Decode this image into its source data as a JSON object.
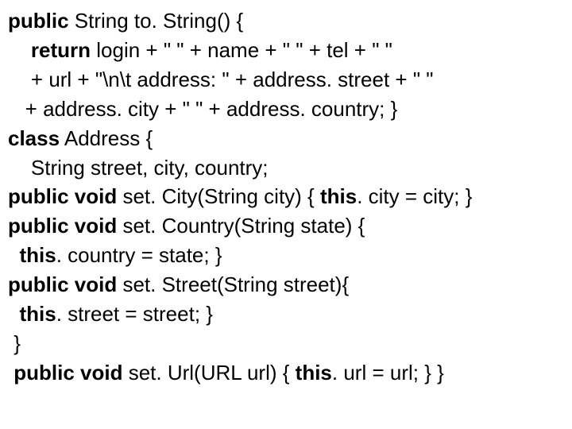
{
  "code": {
    "lines": [
      {
        "indent": "",
        "segments": [
          {
            "t": "public",
            "kw": true
          },
          {
            "t": " String to. String() { ",
            "kw": false
          }
        ]
      },
      {
        "indent": "    ",
        "segments": [
          {
            "t": "return",
            "kw": true
          },
          {
            "t": " login + \" \" + name + \" \" + tel + \" \"",
            "kw": false
          }
        ]
      },
      {
        "indent": "    ",
        "segments": [
          {
            "t": "+ url + \"\\n\\t address: \" + address. street + \" \"",
            "kw": false
          }
        ]
      },
      {
        "indent": "   ",
        "segments": [
          {
            "t": "+ address. city + \" \" + address. country; }",
            "kw": false
          }
        ]
      },
      {
        "indent": "",
        "segments": [
          {
            "t": "class",
            "kw": true
          },
          {
            "t": " Address {",
            "kw": false
          }
        ]
      },
      {
        "indent": "    ",
        "segments": [
          {
            "t": "String street, city, country;",
            "kw": false
          }
        ]
      },
      {
        "indent": "",
        "segments": [
          {
            "t": "public void",
            "kw": true
          },
          {
            "t": " set. City(String city) { ",
            "kw": false
          },
          {
            "t": "this",
            "kw": true
          },
          {
            "t": ". city = city; }",
            "kw": false
          }
        ]
      },
      {
        "indent": "",
        "segments": [
          {
            "t": "public void",
            "kw": true
          },
          {
            "t": " set. Country(String state) {",
            "kw": false
          }
        ]
      },
      {
        "indent": "  ",
        "segments": [
          {
            "t": "this",
            "kw": true
          },
          {
            "t": ". country = state; }",
            "kw": false
          }
        ]
      },
      {
        "indent": "",
        "segments": [
          {
            "t": "public void",
            "kw": true
          },
          {
            "t": " set. Street(String street){",
            "kw": false
          }
        ]
      },
      {
        "indent": "  ",
        "segments": [
          {
            "t": "this",
            "kw": true
          },
          {
            "t": ". street = street; }",
            "kw": false
          }
        ]
      },
      {
        "indent": " ",
        "segments": [
          {
            "t": "}",
            "kw": false
          }
        ]
      },
      {
        "indent": " ",
        "segments": [
          {
            "t": "public void",
            "kw": true
          },
          {
            "t": " set. Url(URL url) { ",
            "kw": false
          },
          {
            "t": "this",
            "kw": true
          },
          {
            "t": ". url = url; } }",
            "kw": false
          }
        ]
      }
    ]
  }
}
